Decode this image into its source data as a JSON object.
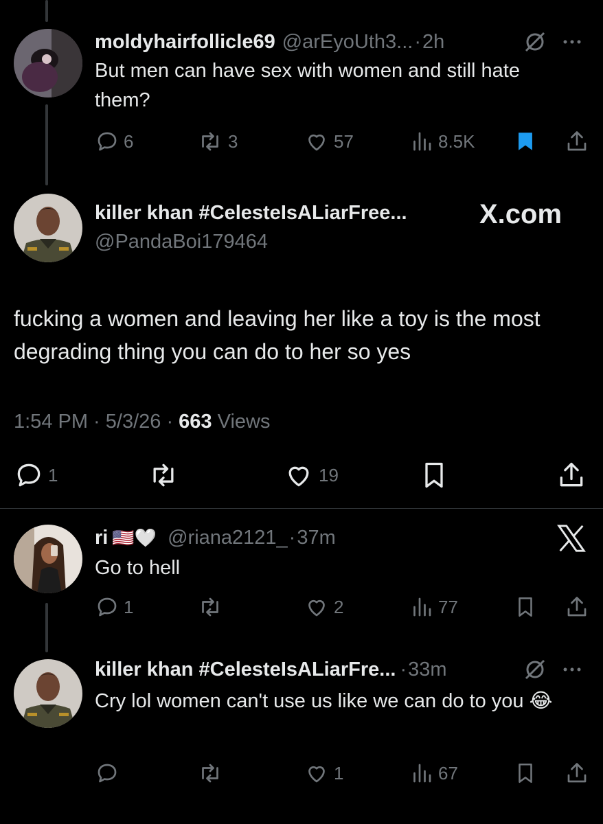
{
  "tweets": [
    {
      "name": "moldyhairfollicle69",
      "handle": "@arEyoUth3...",
      "time": "2h",
      "text": "But men can have sex with women and still hate them?",
      "replies": "6",
      "reposts": "3",
      "likes": "57",
      "views": "8.5K",
      "bookmarked": true
    },
    {
      "name": "killer khan #CelesteIsALiarFree...",
      "handle": "@PandaBoi179464",
      "brand": "X.com",
      "text": "fucking a women and leaving her like a toy  is the most degrading thing you can do to her so yes",
      "timestamp": "1:54 PM · 5/3/26 · ",
      "views_count": "663",
      "views_label": " Views",
      "replies": "1",
      "likes": "19"
    },
    {
      "name": "ri",
      "name_emoji": "🇺🇸🤍",
      "handle": "@riana2121_",
      "time": "37m",
      "text": "Go to hell",
      "replies": "1",
      "likes": "2",
      "views": "77"
    },
    {
      "name": "killer khan #CelesteIsALiarFre...",
      "time": "33m",
      "text": "Cry lol women can't use us like we can do to you 😂",
      "likes": "1",
      "views": "67"
    }
  ],
  "colors": {
    "accent": "#1d9bf0",
    "muted": "#71767b",
    "text": "#e7e9ea",
    "background": "#000000"
  }
}
